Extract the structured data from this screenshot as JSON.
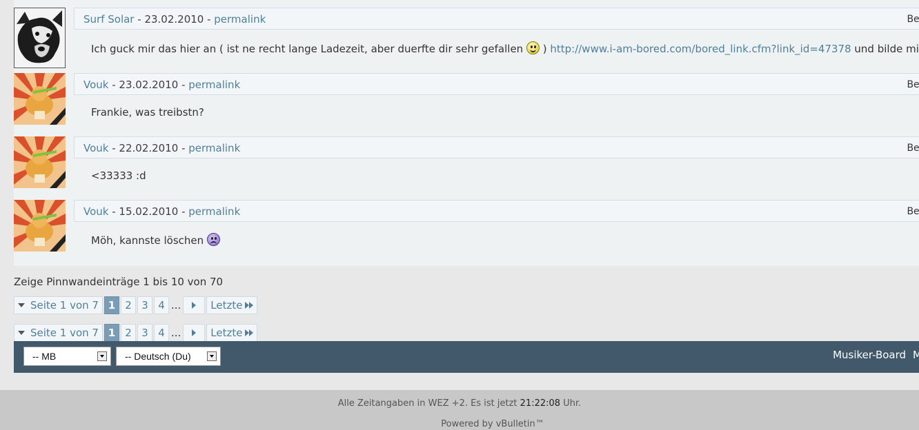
{
  "posts": [
    {
      "author": "Surf Solar",
      "date": "23.02.2010",
      "permalink": "permalink",
      "edit": "Bear",
      "text_before": "Ich guck mir das hier an ( ist ne recht lange Ladezeit, aber duerfte dir sehr gefallen",
      "smiley": "smile-icon",
      "text_mid": " ) ",
      "link": "http://www.i-am-bored.com/bored_link.cfm?link_id=47378",
      "text_after": " und bilde mich uebe"
    },
    {
      "author": "Vouk",
      "date": "23.02.2010",
      "permalink": "permalink",
      "edit": "Bear",
      "text_before": "Frankie, was treibstn?"
    },
    {
      "author": "Vouk",
      "date": "22.02.2010",
      "permalink": "permalink",
      "edit": "Bear",
      "text_before": "<33333 :d"
    },
    {
      "author": "Vouk",
      "date": "15.02.2010",
      "permalink": "permalink",
      "edit": "Bear",
      "text_before": "Möh, kannste löschen",
      "smiley": "frown-icon"
    }
  ],
  "separator": " - ",
  "summary": "Zeige Pinnwandeinträge 1 bis 10 von 70",
  "pagenav": {
    "label": "Seite 1 von 7",
    "pages": [
      "1",
      "2",
      "3",
      "4"
    ],
    "current": "1",
    "dots": "...",
    "last": "Letzte"
  },
  "footer": {
    "style_select": "-- MB",
    "language_select": "-- Deutsch (Du)",
    "links": [
      "Musiker-Board",
      "M"
    ]
  },
  "timeinfo": {
    "prefix": "Alle Zeitangaben in WEZ +2. Es ist jetzt",
    "time": "21:22:08",
    "suffix": "Uhr."
  },
  "powered": "Powered by vBulletin™",
  "colors": {
    "link": "#4f7e9b",
    "footer_bar": "#42596b",
    "current_page": "#7a9db5"
  }
}
